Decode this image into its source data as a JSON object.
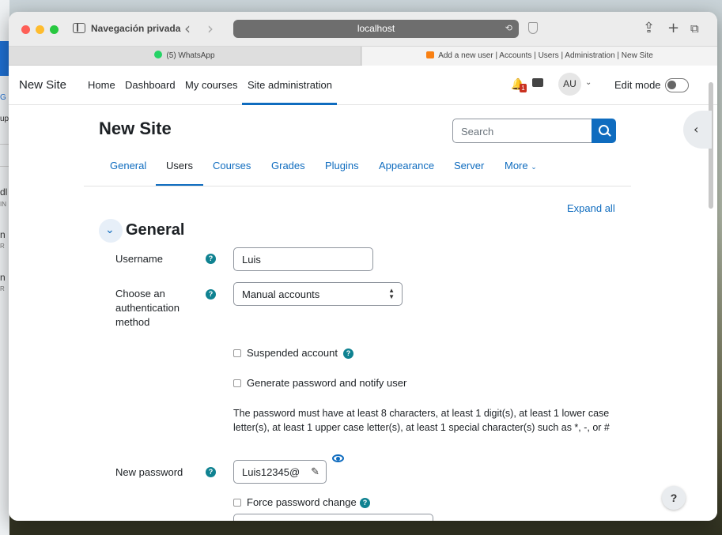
{
  "desktop": {
    "fragments": [
      "G",
      "up",
      "dl",
      "IN",
      "n",
      "R",
      "n",
      "R"
    ]
  },
  "browser": {
    "private_label": "Navegación privada",
    "address": "localhost",
    "tabs": [
      {
        "label": "(5) WhatsApp",
        "icon": "whatsapp-icon"
      },
      {
        "label": "Add a new user | Accounts | Users | Administration | New Site",
        "icon": "moodle-icon"
      }
    ]
  },
  "topnav": {
    "brand": "New Site",
    "links": [
      "Home",
      "Dashboard",
      "My courses",
      "Site administration"
    ],
    "notification_count": "1",
    "avatar_initials": "AU",
    "edit_mode_label": "Edit mode",
    "edit_mode_on": false
  },
  "header": {
    "site_title": "New Site",
    "search_placeholder": "Search"
  },
  "secondary_nav": {
    "tabs": [
      "General",
      "Users",
      "Courses",
      "Grades",
      "Plugins",
      "Appearance",
      "Server",
      "More"
    ],
    "active": "Users"
  },
  "form": {
    "expand_all": "Expand all",
    "section_title": "General",
    "username_label": "Username",
    "username_value": "Luis",
    "auth_label": "Choose an authentication method",
    "auth_value": "Manual accounts",
    "suspended_label": "Suspended account",
    "generate_pw_label": "Generate password and notify user",
    "password_note": "The password must have at least 8 characters, at least 1 digit(s), at least 1 lower case letter(s), at least 1 upper case letter(s), at least 1 special character(s) such as *, -, or #",
    "new_password_label": "New password",
    "new_password_value": "Luis12345@",
    "force_change_label": "Force password change",
    "help_glyph": "?"
  },
  "floating_help": "?",
  "colors": {
    "accent": "#0f6cbf",
    "help_icon": "#0f8291",
    "badge": "#ca3120"
  }
}
